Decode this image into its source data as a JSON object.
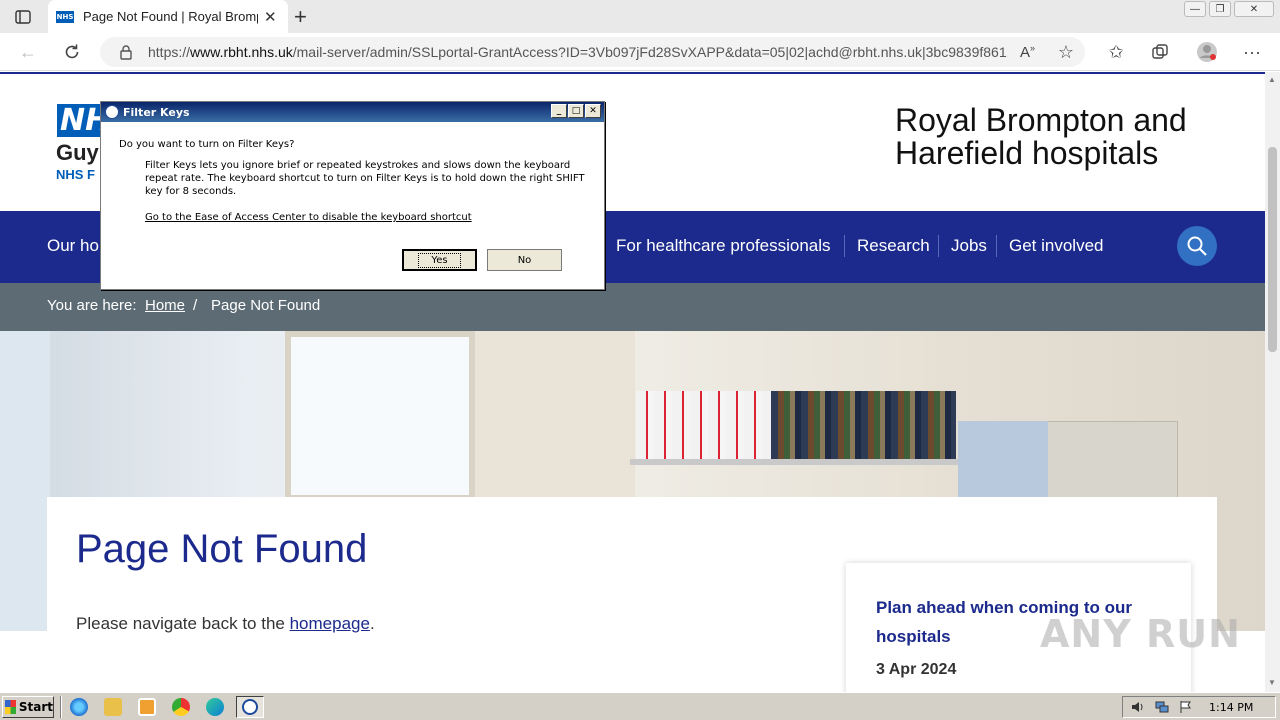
{
  "browser": {
    "tab_title": "Page Not Found | Royal Brompton",
    "favicon_text": "NHS",
    "url_prefix": "https://",
    "url_domain": "www.rbht.nhs.uk",
    "url_path": "/mail-server/admin/SSLportal-GrantAccess?ID=3Vb097jFd28SvXAPP&data=05|02|achd@rbht.nhs.uk|3bc9839f861..."
  },
  "header": {
    "nhs_logo": "NHS",
    "logo_line1": "Guy",
    "logo_line2": "NHS F",
    "site_title_line1": "Royal Brompton and",
    "site_title_line2": "Harefield hospitals"
  },
  "nav": {
    "items": [
      "Our ho",
      "For healthcare professionals",
      "Research",
      "Jobs",
      "Get involved"
    ]
  },
  "breadcrumb": {
    "prefix": "You are here:",
    "home": "Home",
    "separator": "/",
    "current": "Page Not Found"
  },
  "main": {
    "heading": "Page Not Found",
    "text_before": "Please navigate back to the ",
    "link": "homepage",
    "text_after": "."
  },
  "news_card": {
    "heading": "Plan ahead when coming to our hospitals",
    "date": "3 Apr 2024"
  },
  "dialog": {
    "title": "Filter Keys",
    "question": "Do you want to turn on Filter Keys?",
    "description": "Filter Keys lets you ignore brief or repeated keystrokes and slows down the keyboard repeat rate.  The keyboard shortcut to turn on Filter Keys is to hold down the right SHIFT key for 8 seconds.",
    "link": "Go to the Ease of Access Center to disable the keyboard shortcut",
    "yes": "Yes",
    "no": "No"
  },
  "taskbar": {
    "start": "Start",
    "clock": "1:14 PM"
  },
  "watermark": "ANY RUN",
  "colors": {
    "nav_blue": "#1b2a8c",
    "nhs_blue": "#005eb8",
    "breadcrumb_bg": "#5d6b75"
  }
}
